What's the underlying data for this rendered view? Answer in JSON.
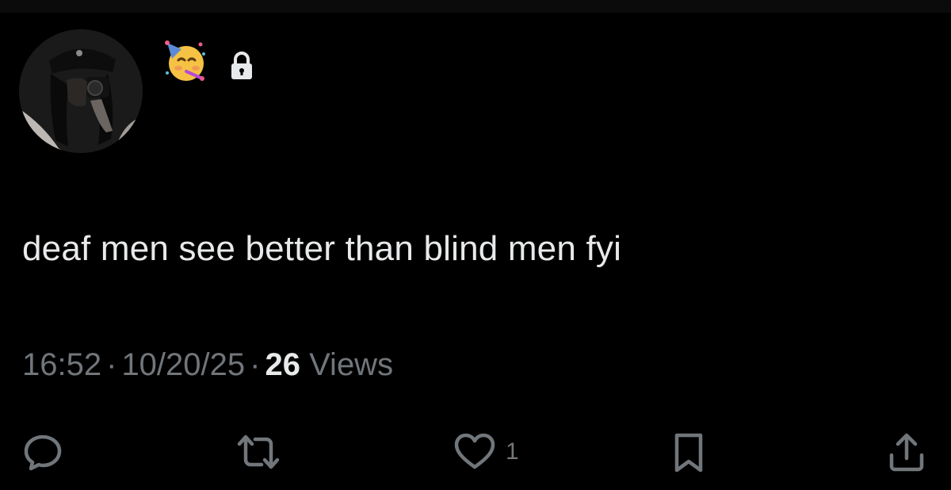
{
  "tweet": {
    "text": "deaf men see better than blind men fyi",
    "time": "16:52",
    "separator": "·",
    "date": "10/20/25",
    "views_count": "26",
    "views_label": "Views"
  },
  "badges": {
    "emoji": "partying-face-emoji",
    "lock": "lock-icon"
  },
  "actions": {
    "reply": {
      "icon": "reply-icon",
      "count": ""
    },
    "repost": {
      "icon": "repost-icon",
      "count": ""
    },
    "like": {
      "icon": "heart-icon",
      "count": "1"
    },
    "bookmark": {
      "icon": "bookmark-icon",
      "count": ""
    },
    "share": {
      "icon": "share-icon",
      "count": ""
    }
  },
  "colors": {
    "background": "#000000",
    "text": "#e7e9ea",
    "muted": "#71767b"
  }
}
